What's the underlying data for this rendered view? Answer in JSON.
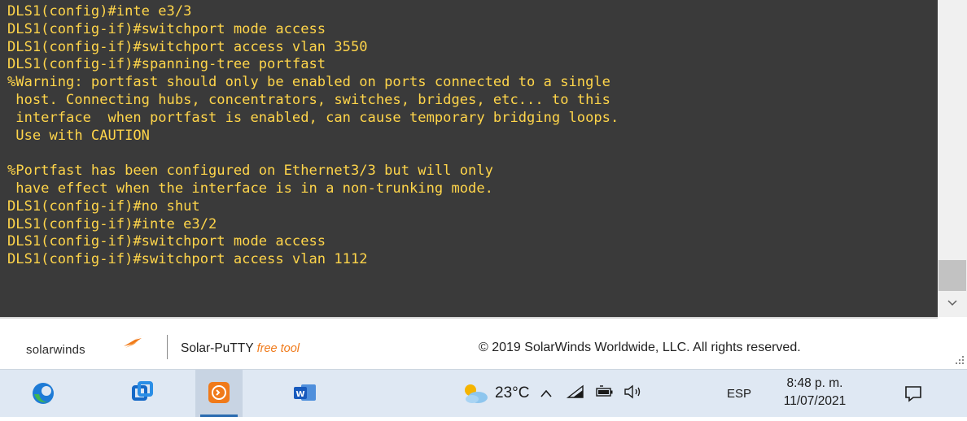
{
  "terminal": {
    "lines": [
      "DLS1(config)#inte e3/3",
      "DLS1(config-if)#switchport mode access",
      "DLS1(config-if)#switchport access vlan 3550",
      "DLS1(config-if)#spanning-tree portfast",
      "%Warning: portfast should only be enabled on ports connected to a single",
      " host. Connecting hubs, concentrators, switches, bridges, etc... to this",
      " interface  when portfast is enabled, can cause temporary bridging loops.",
      " Use with CAUTION",
      "",
      "%Portfast has been configured on Ethernet3/3 but will only",
      " have effect when the interface is in a non-trunking mode.",
      "DLS1(config-if)#no shut",
      "DLS1(config-if)#inte e3/2",
      "DLS1(config-if)#switchport mode access",
      "DLS1(config-if)#switchport access vlan 1112"
    ],
    "text_color": "#ffd54a",
    "background": "#3a3a3a"
  },
  "footer": {
    "brand": "solarwinds",
    "product": "Solar-PuTTY",
    "product_tag": "free tool",
    "copyright": "© 2019 SolarWinds Worldwide, LLC. All rights reserved.",
    "accent": "#f07a1a"
  },
  "taskbar": {
    "apps": [
      {
        "name": "edge-browser-icon"
      },
      {
        "name": "virtual-machine-icon"
      },
      {
        "name": "solar-putty-icon",
        "active": true
      },
      {
        "name": "word-icon"
      }
    ],
    "weather": "23°C",
    "language": "ESP",
    "time": "8:48 p. m.",
    "date": "11/07/2021"
  }
}
